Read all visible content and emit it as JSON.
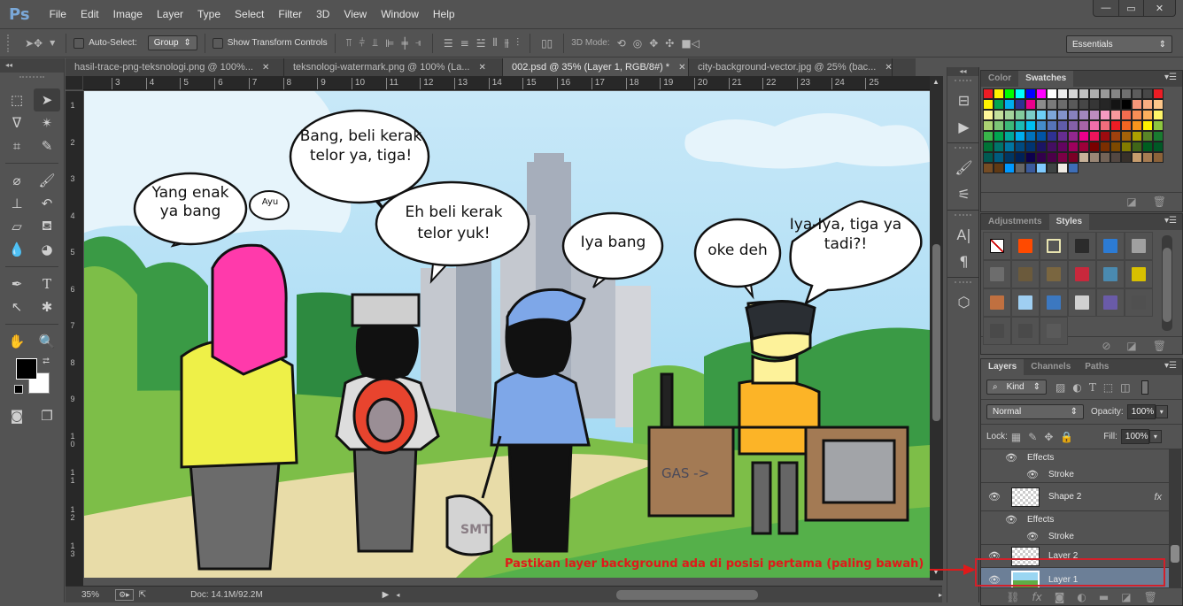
{
  "app": {
    "logo": "Ps"
  },
  "menu": [
    "File",
    "Edit",
    "Image",
    "Layer",
    "Type",
    "Select",
    "Filter",
    "3D",
    "View",
    "Window",
    "Help"
  ],
  "window_controls": {
    "minimize": "—",
    "maximize": "▭",
    "close": "✕"
  },
  "options_bar": {
    "tool_icon": "move-tool-icon",
    "auto_select_label": "Auto-Select:",
    "auto_select_checked": false,
    "group_select": "Group",
    "show_transform_label": "Show Transform Controls",
    "show_transform_checked": false,
    "three_d_mode_label": "3D Mode:",
    "workspace": "Essentials"
  },
  "tabs": [
    {
      "label": "hasil-trace-png-teksnologi.png @ 100%...",
      "active": false
    },
    {
      "label": "teksnologi-watermark.png @ 100% (La...",
      "active": false
    },
    {
      "label": "002.psd @ 35% (Layer 1, RGB/8#) *",
      "active": true
    },
    {
      "label": "city-background-vector.jpg @ 25% (bac...",
      "active": false
    }
  ],
  "ruler": {
    "horizontal": [
      "3",
      "4",
      "5",
      "6",
      "7",
      "8",
      "9",
      "10",
      "11",
      "12",
      "13",
      "14",
      "15",
      "16",
      "17",
      "18",
      "19",
      "20",
      "21",
      "22",
      "23",
      "24",
      "25"
    ],
    "vertical": [
      "1",
      "2",
      "3",
      "4",
      "5",
      "6",
      "7",
      "8",
      "9",
      "10",
      "11",
      "12",
      "13"
    ]
  },
  "canvas": {
    "bubbles": [
      {
        "text": "Yang enak ya bang"
      },
      {
        "text": "Ayu"
      },
      {
        "text": "Bang, beli kerak telor ya, tiga!"
      },
      {
        "text": "Eh beli kerak telor yuk!"
      },
      {
        "text": "Iya bang"
      },
      {
        "text": "oke deh"
      },
      {
        "text": "Iya-Iya, tiga ya tadi?!"
      }
    ],
    "cart_sign": "GAS ->",
    "suitcase_text": "SMT"
  },
  "status": {
    "zoom": "35%",
    "doc": "Doc: 14.1M/92.2M"
  },
  "panels": {
    "color_tabs": [
      "Color",
      "Swatches"
    ],
    "swatches": [
      "#ed1c24",
      "#fff200",
      "#00ff00",
      "#00ffff",
      "#0000ff",
      "#ff00ff",
      "#ffffff",
      "#ebebeb",
      "#d6d6d6",
      "#c2c2c2",
      "#adadad",
      "#999999",
      "#858585",
      "#707070",
      "#5c5c5c",
      "#474747",
      "#ed1c24",
      "#fff200",
      "#00a651",
      "#00aeef",
      "#2e3192",
      "#ec008c",
      "#8c8c8c",
      "#7a7a7a",
      "#6b6b6b",
      "#595959",
      "#474747",
      "#363636",
      "#262626",
      "#141414",
      "#000000",
      "#f7977a",
      "#f9ad81",
      "#fdc68a",
      "#fff79a",
      "#c4df9b",
      "#a3d39c",
      "#82ca9d",
      "#7accc8",
      "#6dcff6",
      "#7da7d9",
      "#8393ca",
      "#8781bd",
      "#a187be",
      "#bd8cbf",
      "#f49ac2",
      "#f6989d",
      "#f26c4f",
      "#f68e56",
      "#fbaf5d",
      "#fff568",
      "#acd373",
      "#7cc576",
      "#3cb878",
      "#1cbbb4",
      "#00bff3",
      "#448ccb",
      "#5674b9",
      "#605ca8",
      "#8560a8",
      "#a864a8",
      "#f06eaa",
      "#f26d7d",
      "#ed1c24",
      "#f26522",
      "#f7941d",
      "#fff200",
      "#8dc63f",
      "#39b54a",
      "#00a651",
      "#00a99d",
      "#00aeef",
      "#0072bc",
      "#0054a6",
      "#2e3192",
      "#662d91",
      "#92278f",
      "#ec008c",
      "#ed145b",
      "#9e0b0f",
      "#a0410d",
      "#a36209",
      "#aba000",
      "#598527",
      "#197b30",
      "#007236",
      "#00746b",
      "#0076a3",
      "#004a80",
      "#003471",
      "#1b1464",
      "#440e62",
      "#630460",
      "#9e005d",
      "#9e0039",
      "#790000",
      "#7b2e00",
      "#7d4900",
      "#827b00",
      "#406618",
      "#005e20",
      "#005826",
      "#005952",
      "#005b7f",
      "#003663",
      "#002157",
      "#0d004c",
      "#32004b",
      "#4b0049",
      "#7b0046",
      "#7a0026",
      "#c7b299",
      "#998675",
      "#736357",
      "#534741",
      "#37302a",
      "#c69c6d",
      "#a67c52",
      "#8c6239",
      "#754c24",
      "#603913",
      "#0099ff",
      "#666666",
      "#3a5a9c",
      "#7fcbff",
      "#3e4343",
      "#efebe4",
      "#3e6eb7"
    ],
    "adjust_tabs": [
      "Adjustments",
      "Styles"
    ],
    "styles": [
      "#ffffff",
      "#ff4a00",
      "#555555",
      "#2b2b2b",
      "#2c7bd4",
      "#a0a0a0",
      "#6d6d6d",
      "#6b5a3c",
      "#7a6640",
      "#c8283c",
      "#4a8ab0",
      "#d8c000",
      "#c07040",
      "#9fcff2",
      "#3c78c0",
      "#d0d0d0",
      "#6a5ba8",
      "#505050",
      "#4a4a4a",
      "#4a4a4a",
      "#5a5a5a"
    ],
    "layer_tabs": [
      "Layers",
      "Channels",
      "Paths"
    ],
    "filter_kind": "Kind",
    "blend_mode": "Normal",
    "opacity_label": "Opacity:",
    "opacity": "100%",
    "lock_label": "Lock:",
    "fill_label": "Fill:",
    "fill": "100%",
    "layers": [
      {
        "name": "Effects",
        "type": "sub",
        "indent": 1
      },
      {
        "name": "Stroke",
        "type": "sub",
        "indent": 2
      },
      {
        "name": "Shape 2",
        "type": "layer",
        "fx": "fx"
      },
      {
        "name": "Effects",
        "type": "sub",
        "indent": 1
      },
      {
        "name": "Stroke",
        "type": "sub",
        "indent": 2
      },
      {
        "name": "Layer 2",
        "type": "layer"
      },
      {
        "name": "Layer 1",
        "type": "layer",
        "selected": true
      }
    ]
  },
  "annotation": {
    "text": "Pastikan layer background ada di posisi pertama (paling bawah)",
    "color": "#e0191a"
  }
}
